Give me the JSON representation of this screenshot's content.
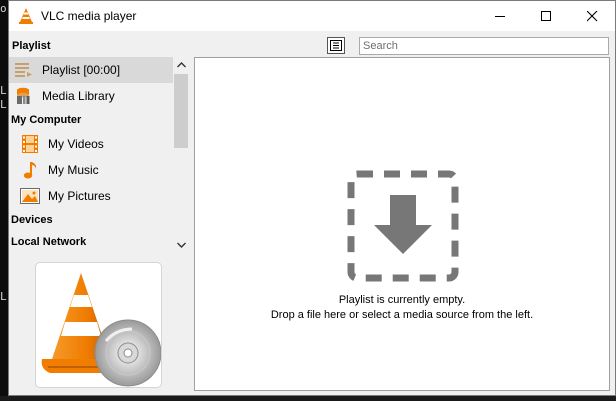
{
  "window": {
    "title": "VLC media player"
  },
  "toolbar": {
    "section_label": "Playlist",
    "search_placeholder": "Search"
  },
  "sidebar": {
    "items": [
      {
        "label": "Playlist [00:00]",
        "icon": "playlist-icon",
        "selected": true
      },
      {
        "label": "Media Library",
        "icon": "media-library-icon",
        "selected": false
      }
    ],
    "categories": {
      "my_computer": "My Computer",
      "devices": "Devices",
      "local_network": "Local Network"
    },
    "computer_items": [
      {
        "label": "My Videos",
        "icon": "film-icon"
      },
      {
        "label": "My Music",
        "icon": "music-note-icon"
      },
      {
        "label": "My Pictures",
        "icon": "picture-icon"
      }
    ]
  },
  "main": {
    "empty_line1": "Playlist is currently empty.",
    "empty_line2": "Drop a file here or select a media source from the left."
  },
  "colors": {
    "vlc_orange": "#f07c00",
    "selection": "#d9d9d9",
    "drop_gray": "#777777"
  }
}
